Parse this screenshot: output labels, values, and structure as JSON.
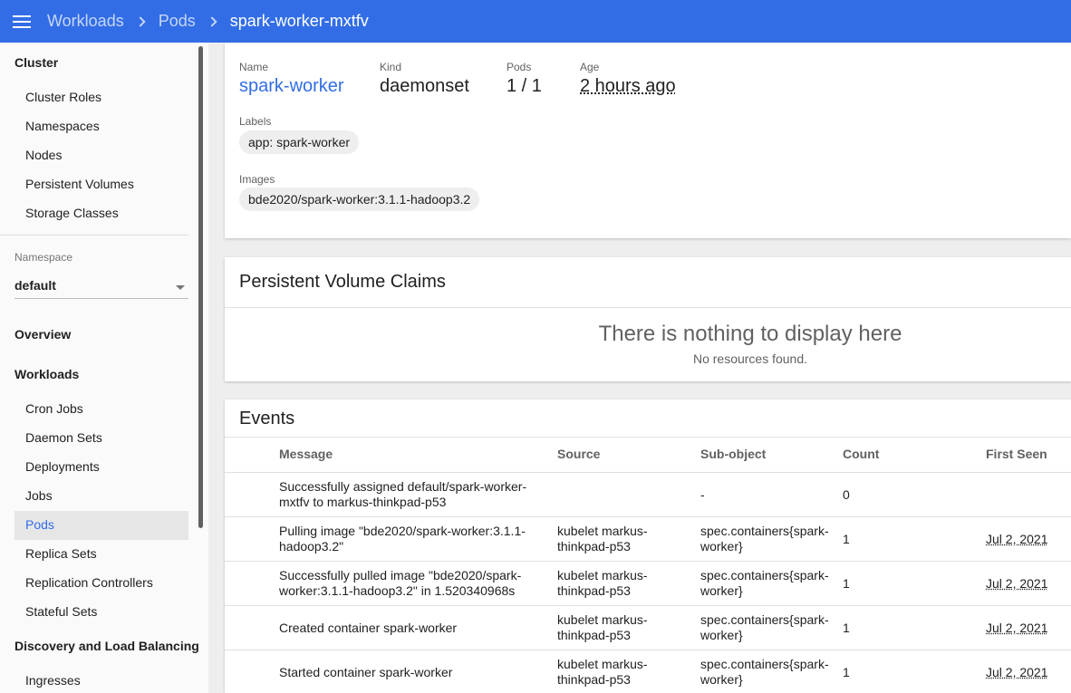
{
  "header": {
    "breadcrumbs": [
      "Workloads",
      "Pods"
    ],
    "current": "spark-worker-mxtfv"
  },
  "sidebar": {
    "cluster_heading": "Cluster",
    "cluster_items": [
      "Cluster Roles",
      "Namespaces",
      "Nodes",
      "Persistent Volumes",
      "Storage Classes"
    ],
    "namespace_label": "Namespace",
    "namespace_value": "default",
    "overview": "Overview",
    "workloads_heading": "Workloads",
    "workload_items": [
      "Cron Jobs",
      "Daemon Sets",
      "Deployments",
      "Jobs",
      "Pods",
      "Replica Sets",
      "Replication Controllers",
      "Stateful Sets"
    ],
    "active_item": "Pods",
    "discovery_heading": "Discovery and Load Balancing",
    "discovery_items": [
      "Ingresses"
    ]
  },
  "controller": {
    "name_label": "Name",
    "name_value": "spark-worker",
    "kind_label": "Kind",
    "kind_value": "daemonset",
    "pods_label": "Pods",
    "pods_value": "1 / 1",
    "age_label": "Age",
    "age_value": "2 hours ago",
    "labels_label": "Labels",
    "labels": [
      "app: spark-worker"
    ],
    "images_label": "Images",
    "images": [
      "bde2020/spark-worker:3.1.1-hadoop3.2"
    ]
  },
  "pvc": {
    "title": "Persistent Volume Claims",
    "empty_title": "There is nothing to display here",
    "empty_sub": "No resources found."
  },
  "events": {
    "title": "Events",
    "columns": [
      "Message",
      "Source",
      "Sub-object",
      "Count",
      "First Seen"
    ],
    "rows": [
      {
        "message": [
          "Successfully assigned default/spark-worker-",
          "mxtfv to markus-thinkpad-p53"
        ],
        "source": [
          "",
          ""
        ],
        "subobject": [
          "-",
          ""
        ],
        "count": "0",
        "first_seen": ""
      },
      {
        "message": [
          "Pulling image \"bde2020/spark-worker:3.1.1-",
          "hadoop3.2\""
        ],
        "source": [
          "kubelet markus-",
          "thinkpad-p53"
        ],
        "subobject": [
          "spec.containers{spark-",
          "worker}"
        ],
        "count": "1",
        "first_seen": "Jul 2, 2021"
      },
      {
        "message": [
          "Successfully pulled image \"bde2020/spark-",
          "worker:3.1.1-hadoop3.2\" in 1.520340968s"
        ],
        "source": [
          "kubelet markus-",
          "thinkpad-p53"
        ],
        "subobject": [
          "spec.containers{spark-",
          "worker}"
        ],
        "count": "1",
        "first_seen": "Jul 2, 2021"
      },
      {
        "message": [
          "Created container spark-worker",
          ""
        ],
        "source": [
          "kubelet markus-",
          "thinkpad-p53"
        ],
        "subobject": [
          "spec.containers{spark-",
          "worker}"
        ],
        "count": "1",
        "first_seen": "Jul 2, 2021"
      },
      {
        "message": [
          "Started container spark-worker",
          ""
        ],
        "source": [
          "kubelet markus-",
          "thinkpad-p53"
        ],
        "subobject": [
          "spec.containers{spark-",
          "worker}"
        ],
        "count": "1",
        "first_seen": "Jul 2, 2021"
      }
    ]
  }
}
